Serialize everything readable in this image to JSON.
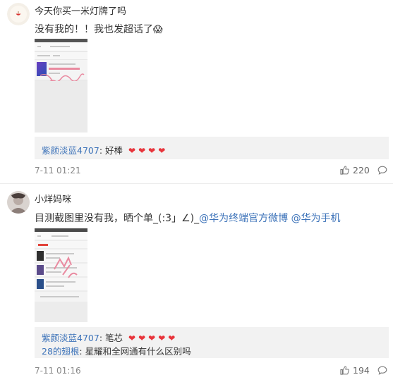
{
  "comments": [
    {
      "username": "今天你买一米灯牌了吗",
      "text": "没有我的！！我也发超话了",
      "emoji": "😱",
      "reply": {
        "lines": [
          {
            "name": "紫颜淡蓝4707",
            "sep": ":",
            "content": "好棒",
            "hearts": 4
          }
        ]
      },
      "time": "7-11 01:21",
      "likes": "220"
    },
    {
      "username": "小烊妈咪",
      "text_prefix": "目测截图里没有我，晒个单_(:3」∠)_",
      "mentions": [
        "@华为终端官方微博",
        "@华为手机"
      ],
      "reply": {
        "lines": [
          {
            "name": "紫颜淡蓝4707",
            "sep": ":",
            "content": "笔芯",
            "hearts": 5
          },
          {
            "name": "28的翅根",
            "sep": ":",
            "content": "星耀和全网通有什么区别吗",
            "hearts": 0
          }
        ]
      },
      "time": "7-11 01:16",
      "likes": "194"
    }
  ],
  "icons": {
    "heart": "❤",
    "like": "thumb-up-icon",
    "reply": "comment-bubble-icon"
  },
  "colors": {
    "mention": "#3d73b9",
    "heart": "#e8343b",
    "reply_bg": "#f2f2f2"
  }
}
